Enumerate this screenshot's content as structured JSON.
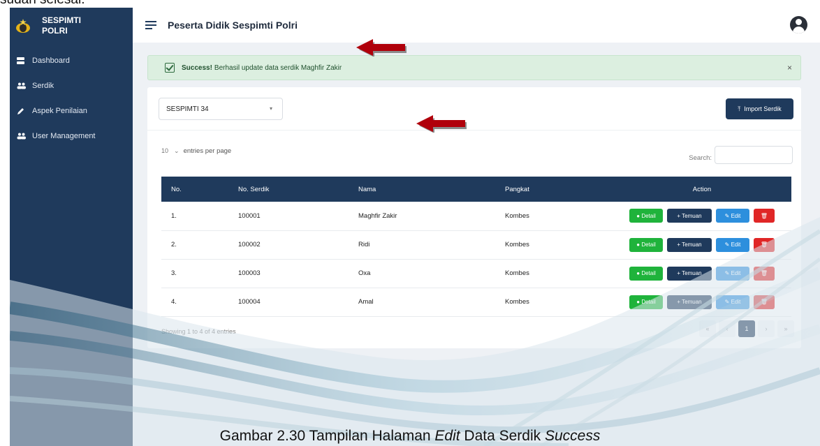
{
  "doc": {
    "top_text": "sudah selesai.",
    "caption": {
      "prefix": "Gambar 2.30 Tampilan Halaman ",
      "italic1": "Edit",
      "middle": " Data Serdik ",
      "italic2": "Success"
    }
  },
  "sidebar": {
    "brand_line1": "SESPIMTI",
    "brand_line2": "POLRI",
    "items": [
      {
        "label": "Dashboard",
        "icon": "dashboard-icon"
      },
      {
        "label": "Serdik",
        "icon": "users-icon"
      },
      {
        "label": "Aspek Penilaian",
        "icon": "pen-icon"
      },
      {
        "label": "User Management",
        "icon": "users-icon"
      }
    ]
  },
  "header": {
    "title": "Peserta Didik Sespimti Polri"
  },
  "alert": {
    "strong": "Success!",
    "message": "Berhasil update data serdik Maghfir Zakir",
    "close": "×"
  },
  "card": {
    "select_value": "SESPIMTI 34",
    "import_label": "Import Serdik",
    "per_page_value": "10",
    "per_page_label": "entries per page",
    "search_label": "Search:"
  },
  "table": {
    "columns": [
      "No.",
      "No. Serdik",
      "Nama",
      "Pangkat",
      "Action"
    ],
    "rows": [
      {
        "no": "1.",
        "serdik": "100001",
        "nama": "Maghfir Zakir",
        "pangkat": "Kombes"
      },
      {
        "no": "2.",
        "serdik": "100002",
        "nama": "Ridi",
        "pangkat": "Kombes"
      },
      {
        "no": "3.",
        "serdik": "100003",
        "nama": "Oxa",
        "pangkat": "Kombes"
      },
      {
        "no": "4.",
        "serdik": "100004",
        "nama": "Amal",
        "pangkat": "Kombes"
      }
    ],
    "actions": {
      "detail": "Detail",
      "temuan": "+ Temuan",
      "edit": "Edit",
      "delete": "🗑"
    }
  },
  "footer": {
    "info": "Showing 1 to 4 of 4 entries",
    "pager": [
      "«",
      "‹",
      "1",
      "›",
      "»"
    ]
  },
  "colors": {
    "sidebar": "#1f3a5c",
    "detail": "#1fb33b",
    "edit": "#2d8fdd",
    "delete": "#e02626",
    "annotation_arrow": "#b0000b"
  }
}
